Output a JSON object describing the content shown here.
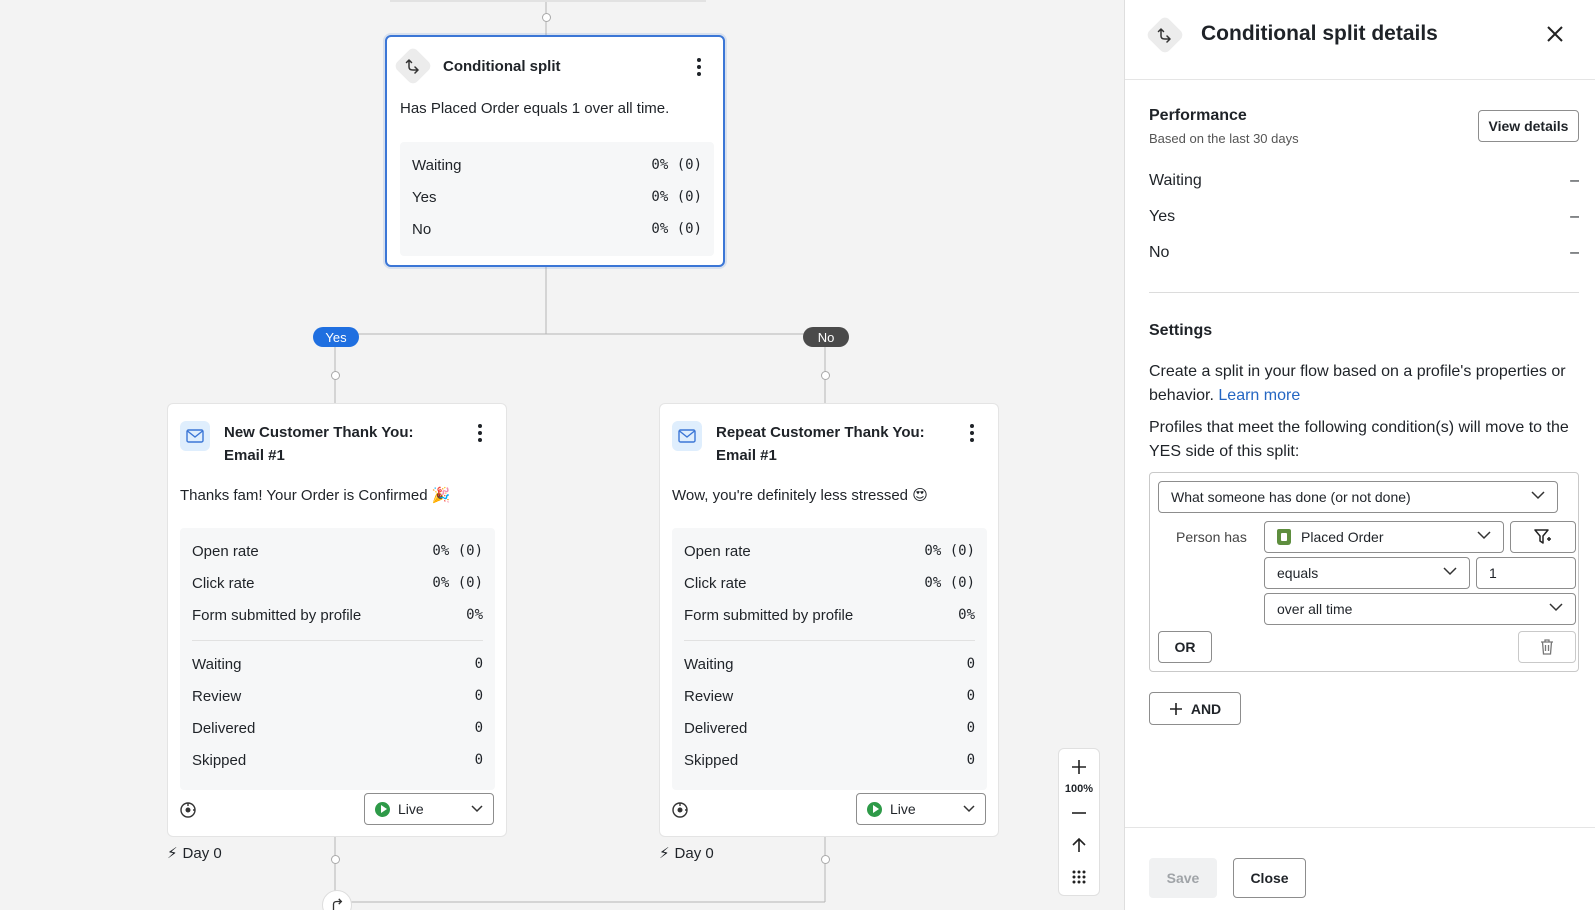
{
  "canvas": {
    "split_node": {
      "title": "Conditional split",
      "description": "Has Placed Order equals 1 over all time.",
      "stats": [
        {
          "label": "Waiting",
          "value": "0% (0)"
        },
        {
          "label": "Yes",
          "value": "0% (0)"
        },
        {
          "label": "No",
          "value": "0% (0)"
        }
      ]
    },
    "branches": {
      "yes": "Yes",
      "no": "No"
    },
    "email_left": {
      "title_line1": "New Customer Thank You:",
      "title_line2": "Email #1",
      "subject": "Thanks fam! Your Order is Confirmed 🎉",
      "rates": [
        {
          "label": "Open rate",
          "value": "0% (0)"
        },
        {
          "label": "Click rate",
          "value": "0% (0)"
        },
        {
          "label": "Form submitted by profile",
          "value": "0%"
        }
      ],
      "counts": [
        {
          "label": "Waiting",
          "value": "0"
        },
        {
          "label": "Review",
          "value": "0"
        },
        {
          "label": "Delivered",
          "value": "0"
        },
        {
          "label": "Skipped",
          "value": "0"
        }
      ],
      "status": "Live",
      "day": "Day 0"
    },
    "email_right": {
      "title_line1": "Repeat Customer Thank You:",
      "title_line2": "Email #1",
      "subject": "Wow, you're definitely less stressed 😍",
      "rates": [
        {
          "label": "Open rate",
          "value": "0% (0)"
        },
        {
          "label": "Click rate",
          "value": "0% (0)"
        },
        {
          "label": "Form submitted by profile",
          "value": "0%"
        }
      ],
      "counts": [
        {
          "label": "Waiting",
          "value": "0"
        },
        {
          "label": "Review",
          "value": "0"
        },
        {
          "label": "Delivered",
          "value": "0"
        },
        {
          "label": "Skipped",
          "value": "0"
        }
      ],
      "status": "Live",
      "day": "Day 0"
    },
    "zoom": {
      "level": "100%"
    },
    "colors": {
      "yes_pill": "#1f6fe0",
      "no_pill": "#4a4a4a",
      "selected_border": "#3b76d6",
      "live": "#2e9a48"
    }
  },
  "panel": {
    "title": "Conditional split details",
    "performance": {
      "title": "Performance",
      "subtitle": "Based on the last 30 days",
      "view_details": "View details",
      "rows": [
        {
          "label": "Waiting",
          "value": "–"
        },
        {
          "label": "Yes",
          "value": "–"
        },
        {
          "label": "No",
          "value": "–"
        }
      ]
    },
    "settings": {
      "title": "Settings",
      "description": "Create a split in your flow based on a profile's properties or behavior.",
      "learn_more": "Learn more",
      "condition_intro": "Profiles that meet the following condition(s) will move to the YES side of this split:",
      "condition_type": "What someone has done (or not done)",
      "person_has_label": "Person has",
      "metric": "Placed Order",
      "operator": "equals",
      "value": "1",
      "timeframe": "over all time",
      "or_label": "OR",
      "and_label": "AND"
    },
    "footer": {
      "save": "Save",
      "close": "Close"
    }
  }
}
